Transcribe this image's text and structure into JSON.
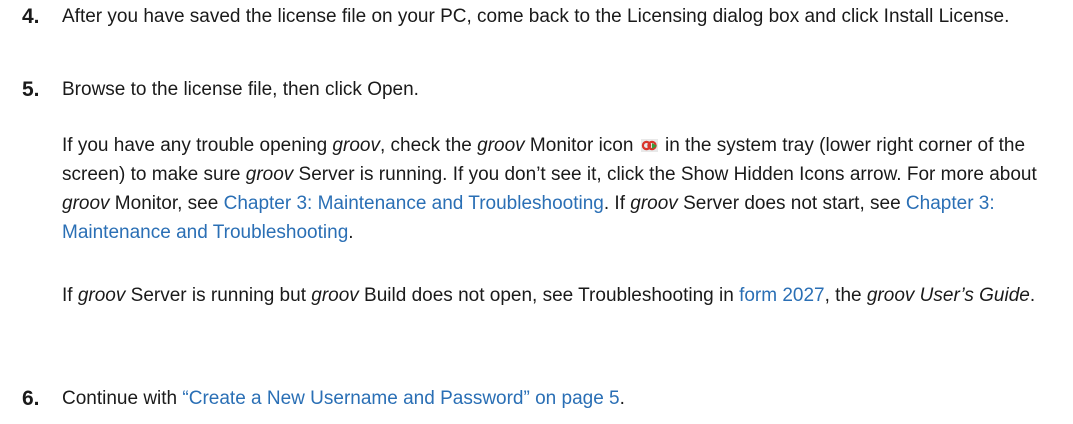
{
  "steps": [
    {
      "number": "4.",
      "text": "After you have saved the license file on your PC, come back to the Licensing dialog box and click Install License."
    },
    {
      "number": "5.",
      "text": "Browse to the license file, then click Open."
    },
    {
      "number": "6.",
      "text_before": "Continue with ",
      "link": "“Create a New Username and Password” on page 5",
      "text_after": "."
    }
  ],
  "para1": {
    "t1": "If you have any trouble opening ",
    "groov": "groov",
    "t2": ", check the ",
    "t3": " Monitor icon ",
    "icon": "groov-monitor-tray-icon",
    "t4": " in the system tray (lower right corner of the screen) to make sure ",
    "t5": " Server is running. If you don’t see it, click the Show Hidden Icons arrow. For more about ",
    "t6": " Monitor, see ",
    "link1": "Chapter 3: Maintenance and Troubleshooting",
    "t7": ". If ",
    "t8": " Server does not start, see ",
    "link2": "Chapter 3: Maintenance and Troubleshooting",
    "t9": "."
  },
  "para2": {
    "t1": " Server is running but ",
    "t2": " Build does not open, see Troubleshooting in ",
    "link": "form 2027",
    "t3": ", the ",
    "guide": "groov User’s Guide",
    "t4": ".",
    "lead": "If "
  },
  "colors": {
    "link": "#2a6fb5",
    "icon_body": "#d9342b",
    "icon_accent": "#3a9b3a"
  }
}
